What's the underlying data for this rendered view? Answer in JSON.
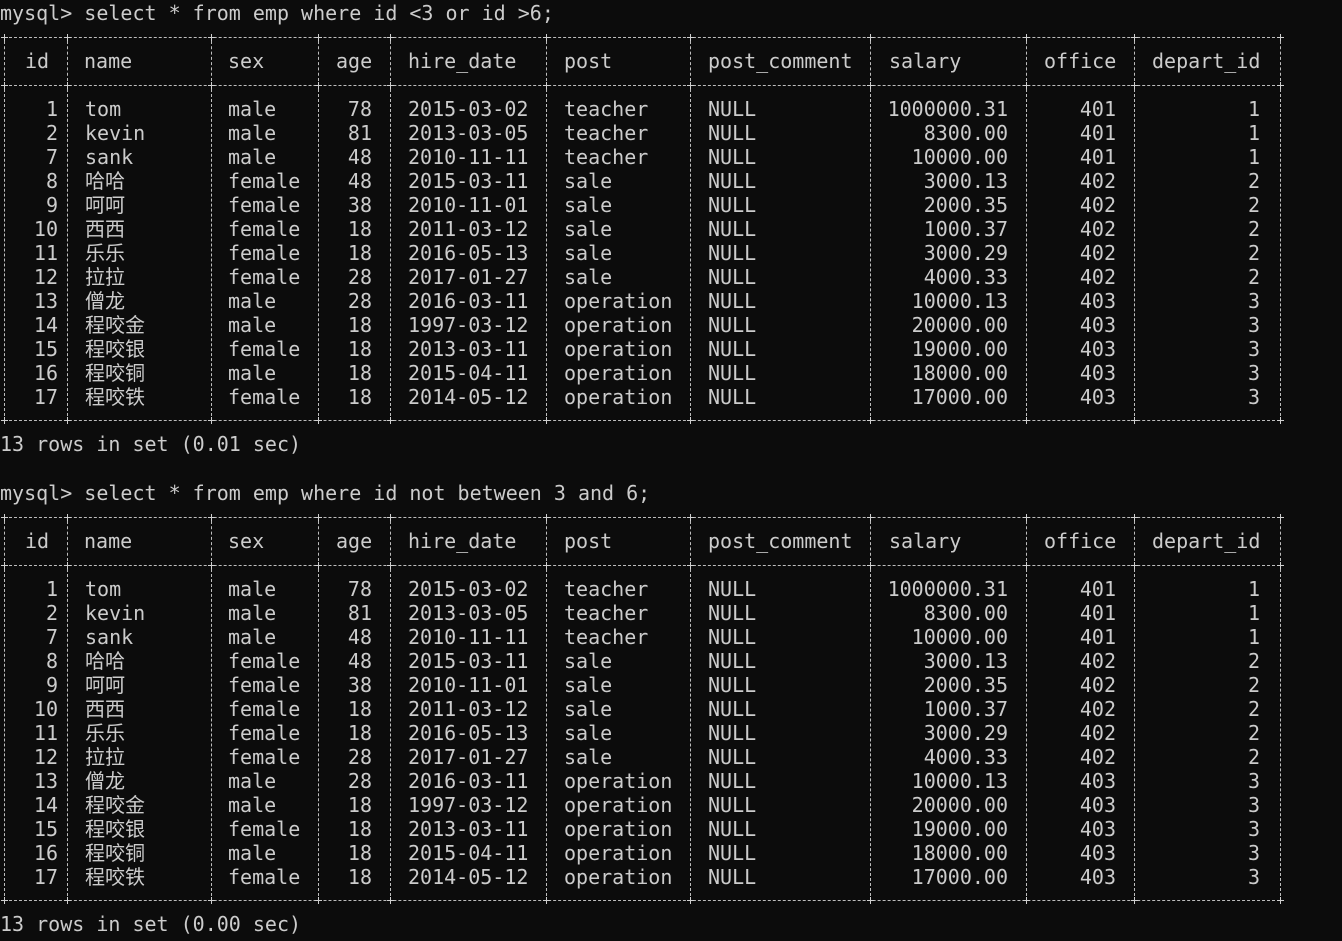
{
  "terminal": {
    "query1": "mysql> select * from emp where id <3 or id >6;",
    "result1": "13 rows in set (0.01 sec)",
    "query2": "mysql> select * from emp where id not between 3 and 6;",
    "result2": "13 rows in set (0.00 sec)"
  },
  "table": {
    "columns": [
      "id",
      "name",
      "sex",
      "age",
      "hire_date",
      "post",
      "post_comment",
      "salary",
      "office",
      "depart_id"
    ],
    "rows": [
      [
        "1",
        "tom",
        "male",
        "78",
        "2015-03-02",
        "teacher",
        "NULL",
        "1000000.31",
        "401",
        "1"
      ],
      [
        "2",
        "kevin",
        "male",
        "81",
        "2013-03-05",
        "teacher",
        "NULL",
        "8300.00",
        "401",
        "1"
      ],
      [
        "7",
        "sank",
        "male",
        "48",
        "2010-11-11",
        "teacher",
        "NULL",
        "10000.00",
        "401",
        "1"
      ],
      [
        "8",
        "哈哈",
        "female",
        "48",
        "2015-03-11",
        "sale",
        "NULL",
        "3000.13",
        "402",
        "2"
      ],
      [
        "9",
        "呵呵",
        "female",
        "38",
        "2010-11-01",
        "sale",
        "NULL",
        "2000.35",
        "402",
        "2"
      ],
      [
        "10",
        "西西",
        "female",
        "18",
        "2011-03-12",
        "sale",
        "NULL",
        "1000.37",
        "402",
        "2"
      ],
      [
        "11",
        "乐乐",
        "female",
        "18",
        "2016-05-13",
        "sale",
        "NULL",
        "3000.29",
        "402",
        "2"
      ],
      [
        "12",
        "拉拉",
        "female",
        "28",
        "2017-01-27",
        "sale",
        "NULL",
        "4000.33",
        "402",
        "2"
      ],
      [
        "13",
        "僧龙",
        "male",
        "28",
        "2016-03-11",
        "operation",
        "NULL",
        "10000.13",
        "403",
        "3"
      ],
      [
        "14",
        "程咬金",
        "male",
        "18",
        "1997-03-12",
        "operation",
        "NULL",
        "20000.00",
        "403",
        "3"
      ],
      [
        "15",
        "程咬银",
        "female",
        "18",
        "2013-03-11",
        "operation",
        "NULL",
        "19000.00",
        "403",
        "3"
      ],
      [
        "16",
        "程咬铜",
        "male",
        "18",
        "2015-04-11",
        "operation",
        "NULL",
        "18000.00",
        "403",
        "3"
      ],
      [
        "17",
        "程咬铁",
        "female",
        "18",
        "2014-05-12",
        "operation",
        "NULL",
        "17000.00",
        "403",
        "3"
      ]
    ]
  },
  "colors": {
    "background": "#0c0c0c",
    "text": "#cccccc"
  }
}
